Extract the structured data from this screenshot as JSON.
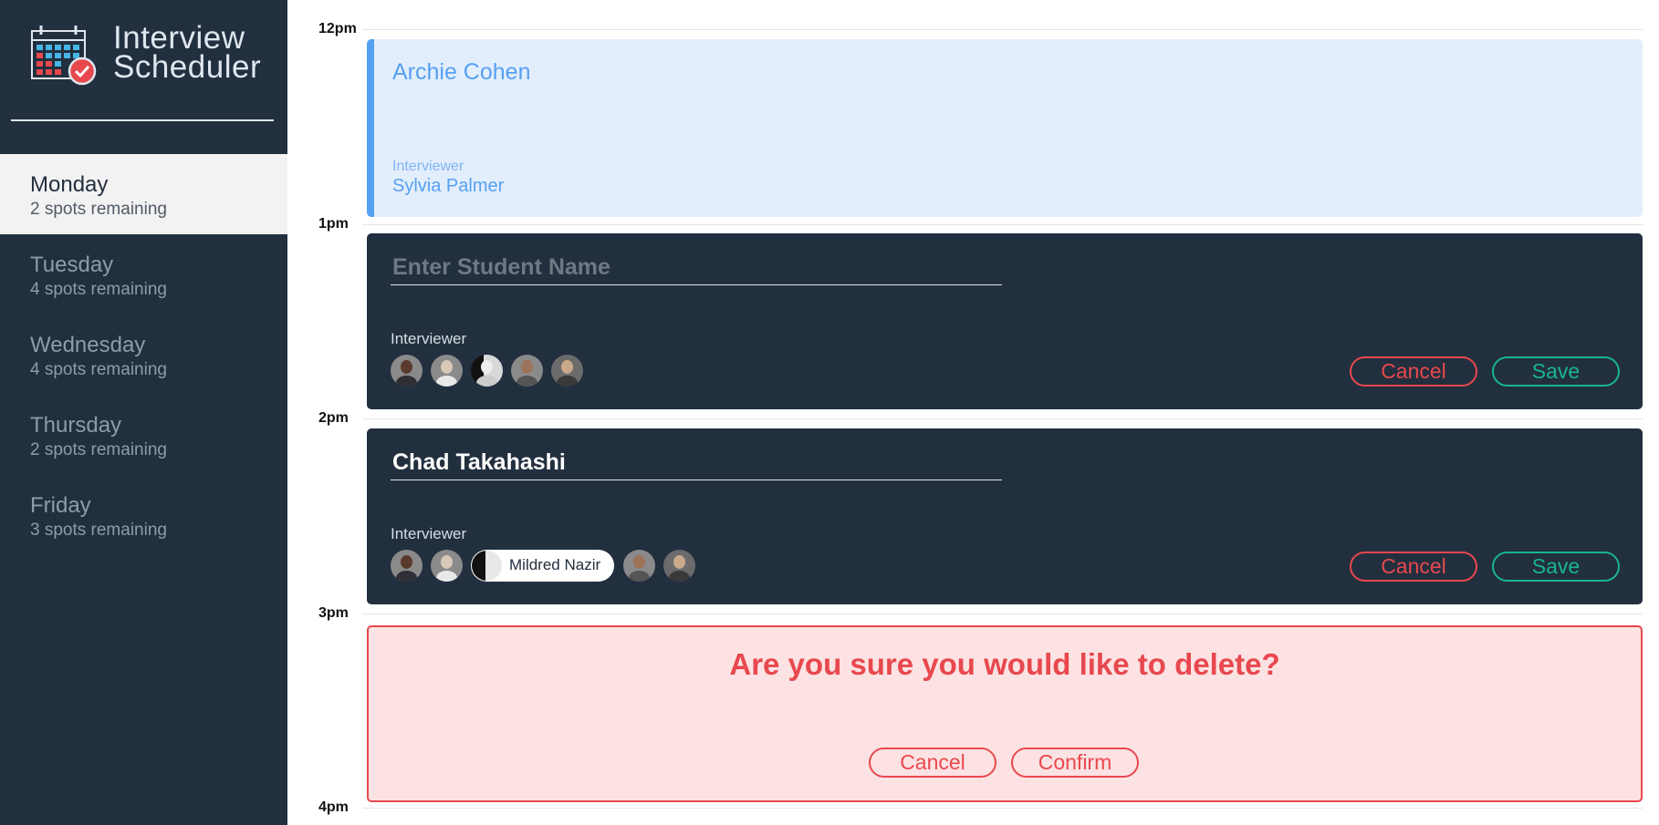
{
  "app": {
    "title_line1": "Interview",
    "title_line2": "Scheduler"
  },
  "sidebar": {
    "days": [
      {
        "name": "Monday",
        "spots": "2 spots remaining",
        "selected": true
      },
      {
        "name": "Tuesday",
        "spots": "4 spots remaining"
      },
      {
        "name": "Wednesday",
        "spots": "4 spots remaining"
      },
      {
        "name": "Thursday",
        "spots": "2 spots remaining"
      },
      {
        "name": "Friday",
        "spots": "3 spots remaining"
      }
    ]
  },
  "schedule": {
    "times": [
      "12pm",
      "1pm",
      "2pm",
      "3pm",
      "4pm"
    ],
    "appointment_show": {
      "student": "Archie Cohen",
      "interviewer_label": "Interviewer",
      "interviewer": "Sylvia Palmer"
    },
    "appointment_create": {
      "student_value": "",
      "placeholder": "Enter Student Name",
      "interviewer_label": "Interviewer",
      "cancel_label": "Cancel",
      "save_label": "Save"
    },
    "appointment_edit": {
      "student_value": "Chad Takahashi",
      "placeholder": "Enter Student Name",
      "interviewer_label": "Interviewer",
      "selected_interviewer": "Mildred Nazir",
      "cancel_label": "Cancel",
      "save_label": "Save"
    },
    "appointment_confirm": {
      "message": "Are you sure you would like to delete?",
      "cancel_label": "Cancel",
      "confirm_label": "Confirm"
    }
  },
  "colors": {
    "sidebar_bg": "#222f3e",
    "accent_blue": "#56a0f3",
    "danger": "#e8484e",
    "success": "#18b591"
  }
}
